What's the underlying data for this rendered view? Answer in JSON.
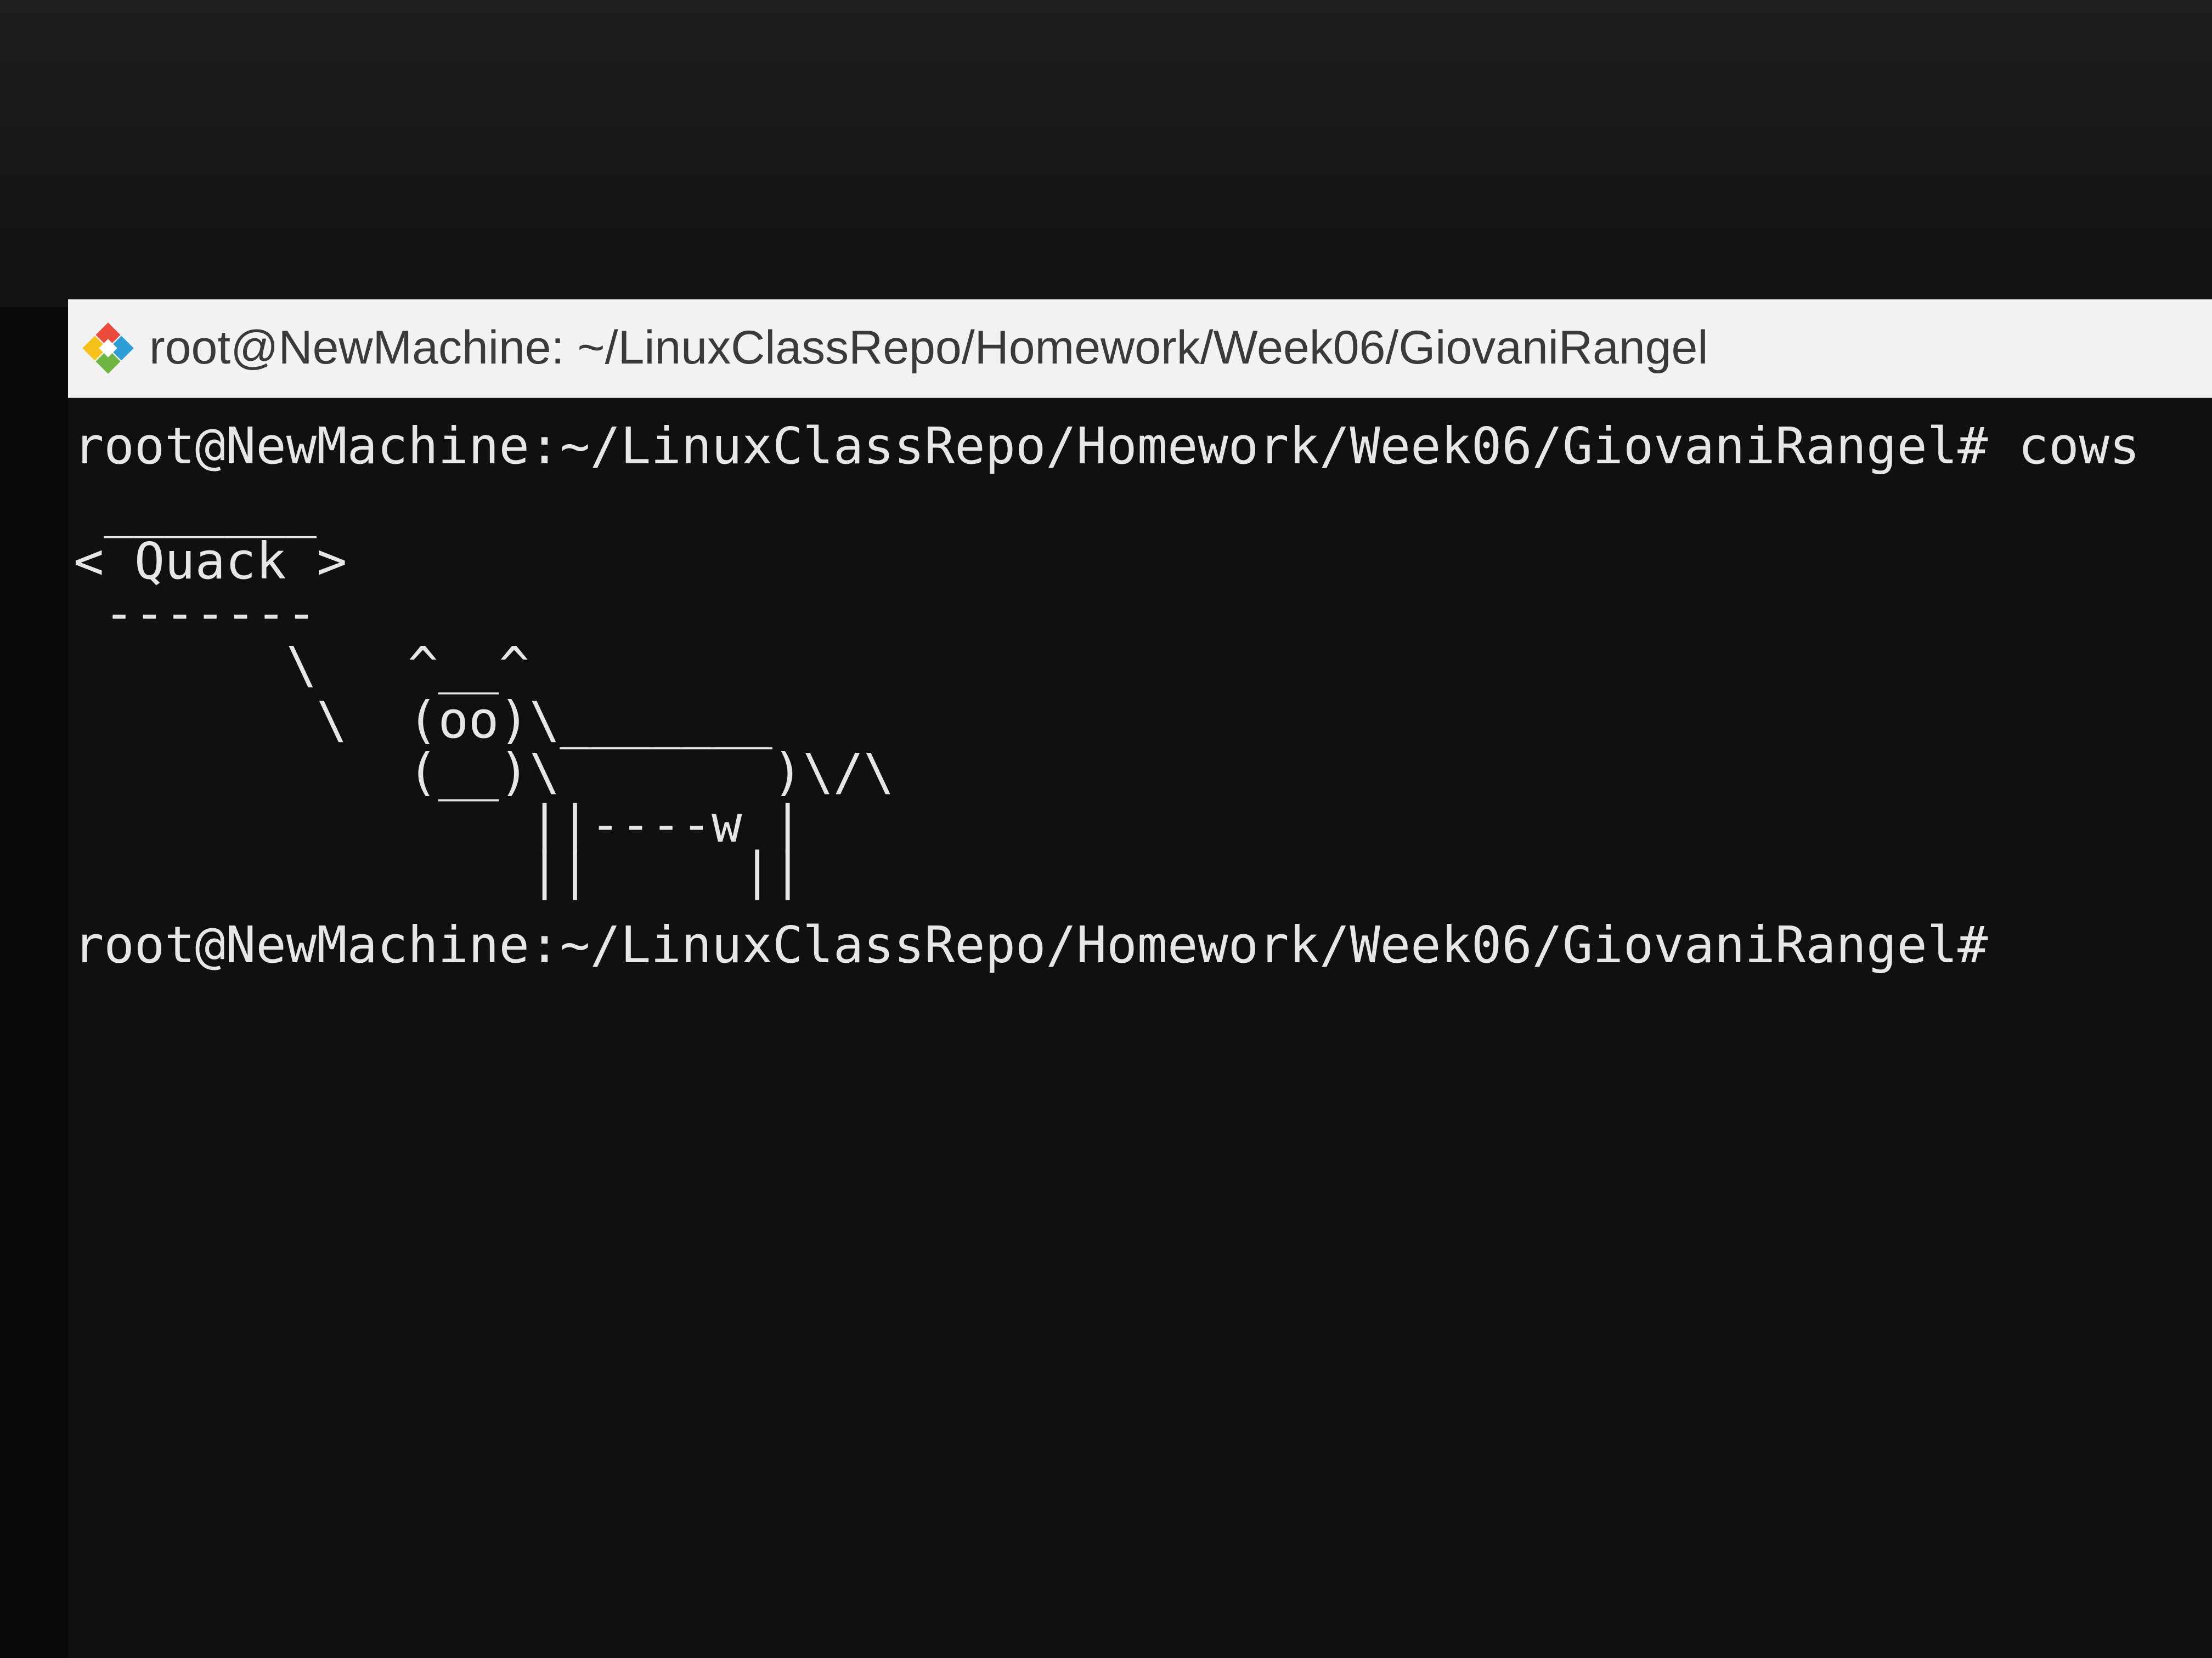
{
  "window": {
    "title": "root@NewMachine: ~/LinuxClassRepo/Homework/Week06/GiovaniRangel",
    "icon": "git-bash-icon"
  },
  "terminal": {
    "prompt_command": "root@NewMachine:~/LinuxClassRepo/Homework/Week06/GiovaniRangel# cows",
    "cow_lines": [
      " _______",
      "< Quack >",
      " -------",
      "       \\   ^__^",
      "        \\  (oo)\\_______",
      "           (__)\\       )\\/\\",
      "               ||----w |",
      "               ||     ||"
    ],
    "final_prompt": "root@NewMachine:~/LinuxClassRepo/Homework/Week06/GiovaniRangel#"
  },
  "colors": {
    "background": "#0c0c0c",
    "text": "#e6e6e6",
    "titlebar": "#f2f2f2"
  }
}
